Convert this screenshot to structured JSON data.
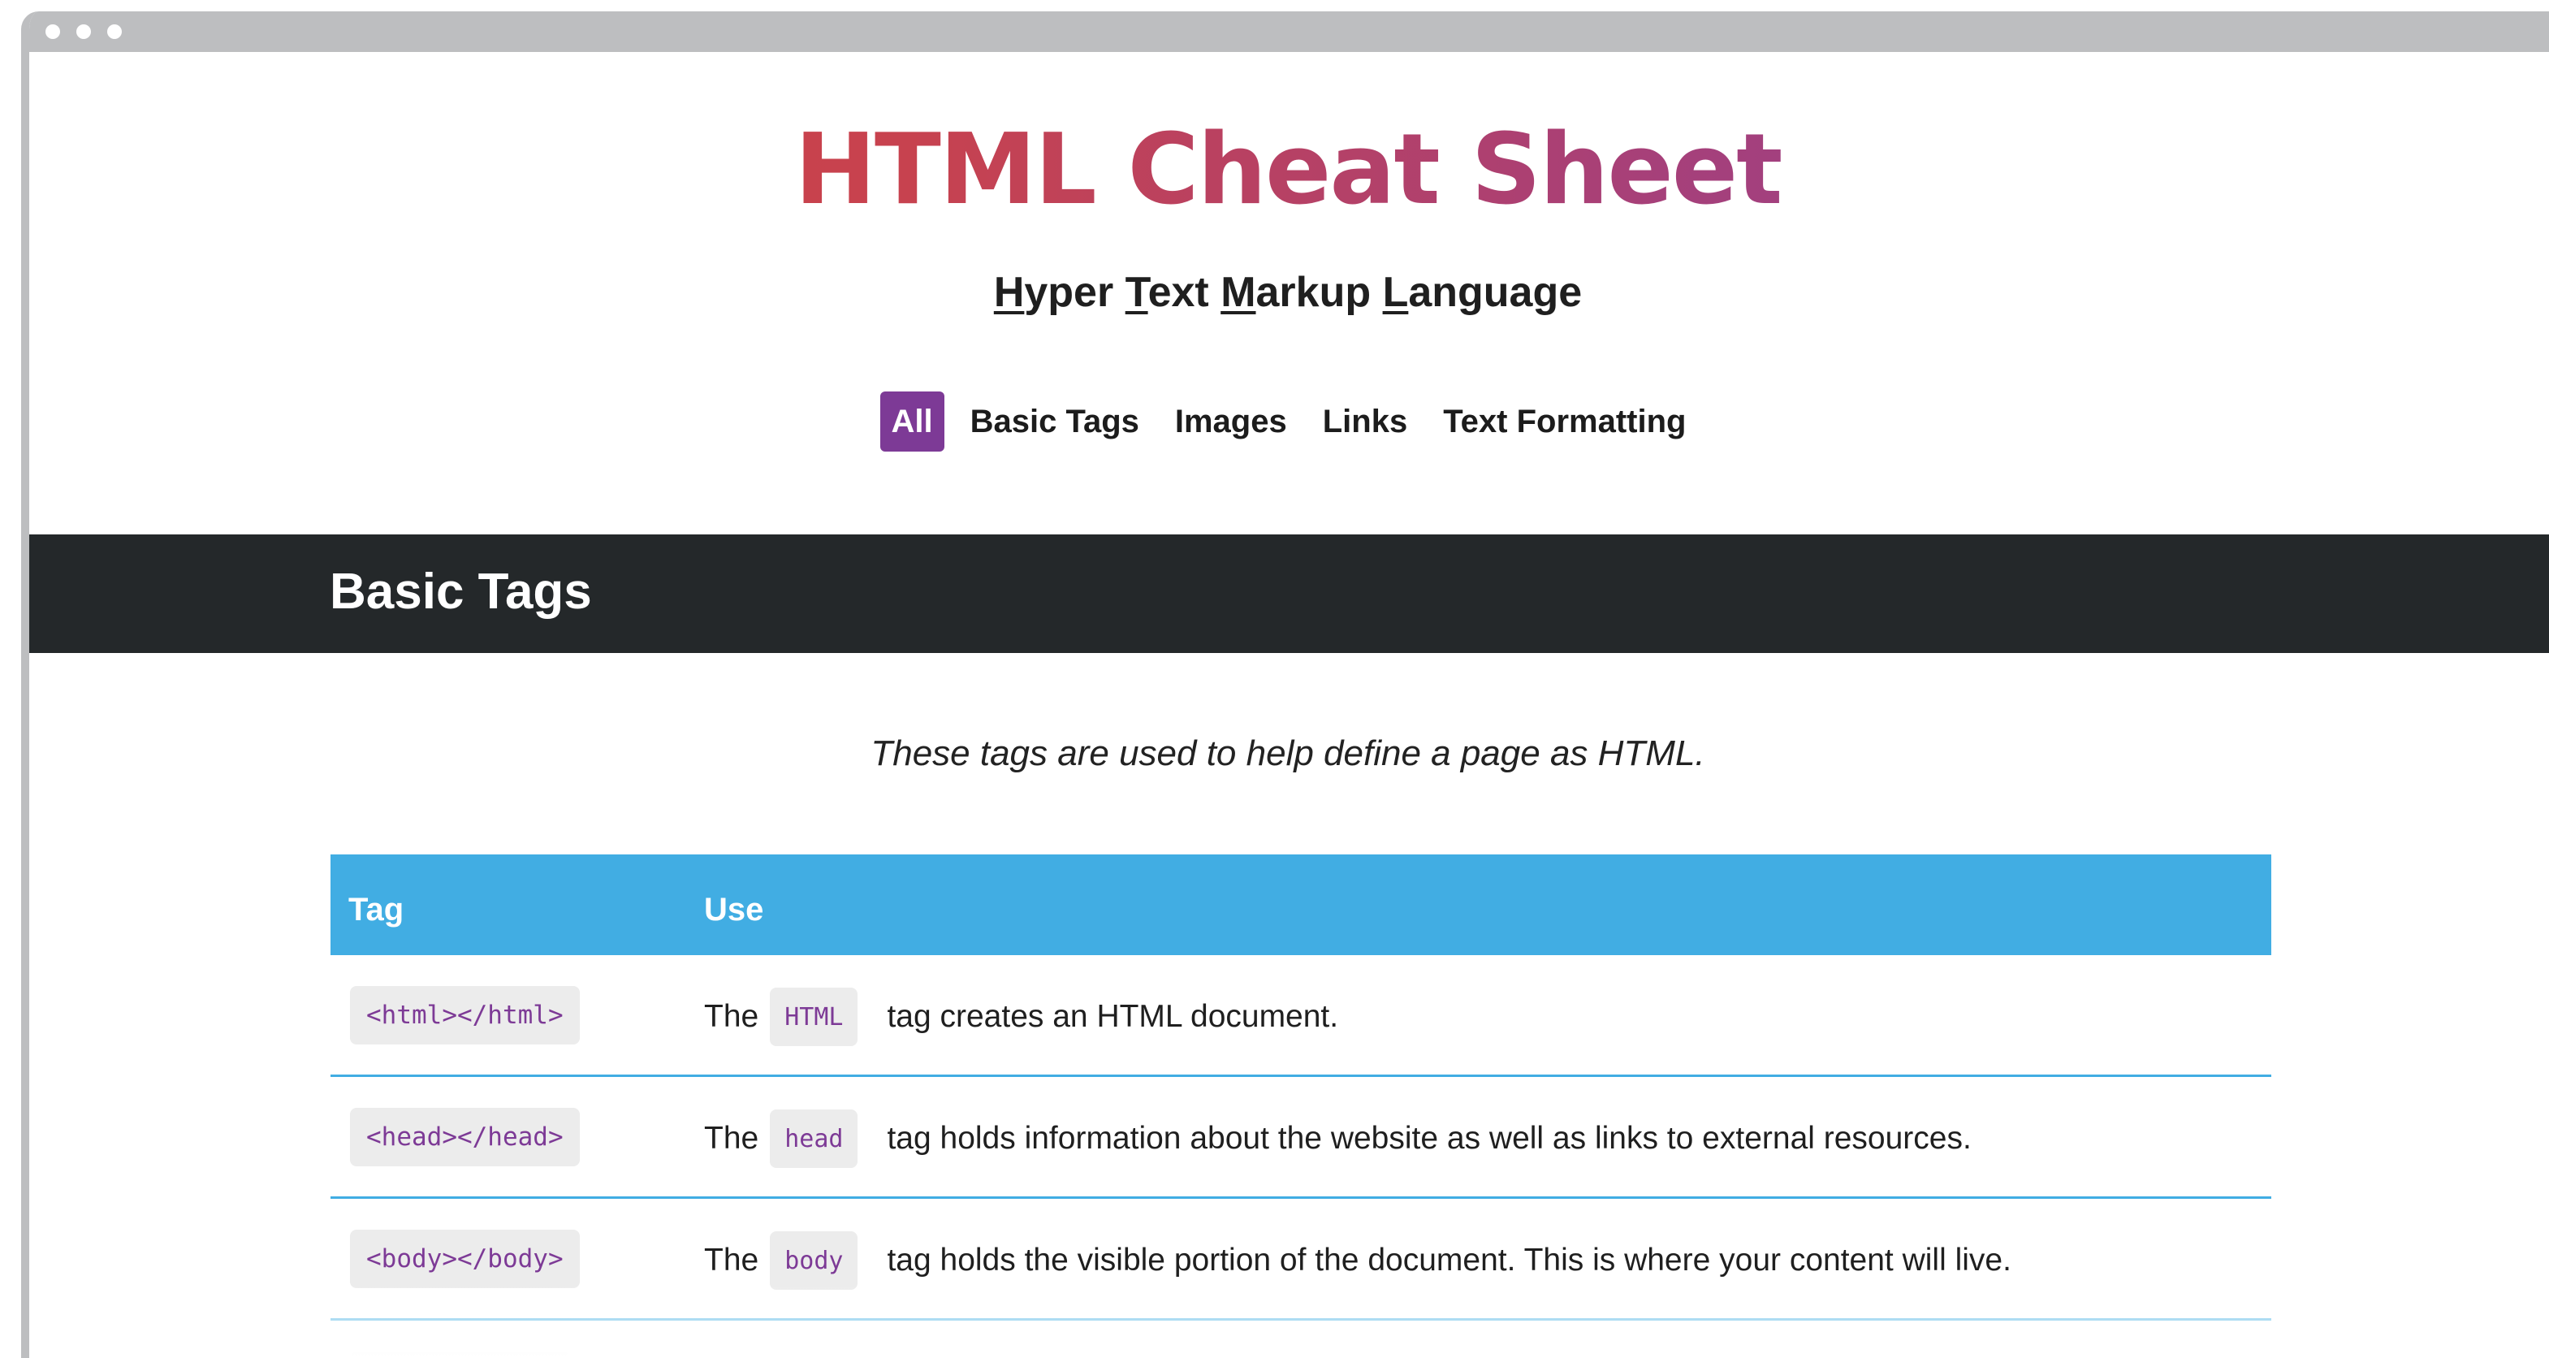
{
  "header": {
    "title": "HTML Cheat Sheet",
    "subtitle": {
      "parts": [
        {
          "u": "H",
          "rest": "yper "
        },
        {
          "u": "T",
          "rest": "ext "
        },
        {
          "u": "M",
          "rest": "arkup "
        },
        {
          "u": "L",
          "rest": "anguage"
        }
      ]
    }
  },
  "nav": {
    "items": [
      {
        "label": "All",
        "active": true
      },
      {
        "label": "Basic Tags",
        "active": false
      },
      {
        "label": "Images",
        "active": false
      },
      {
        "label": "Links",
        "active": false
      },
      {
        "label": "Text Formatting",
        "active": false
      }
    ]
  },
  "section": {
    "title": "Basic Tags",
    "description": "These tags are used to help define a page as HTML."
  },
  "table": {
    "headers": {
      "tag": "Tag",
      "use": "Use"
    },
    "rows": [
      {
        "tag": "<html></html>",
        "pre": "The",
        "chip": "HTML",
        "post": "tag creates an HTML document."
      },
      {
        "tag": "<head></head>",
        "pre": "The",
        "chip": "head",
        "post": "tag holds information about the website as well as links to external resources."
      },
      {
        "tag": "<body></body>",
        "pre": "The",
        "chip": "body",
        "post": "tag holds the visible portion of the document. This is where your content will live."
      }
    ]
  },
  "colors": {
    "accent_purple": "#7d3a96",
    "table_header_blue": "#41ade3",
    "section_bar_dark": "#24282a",
    "title_gradient_start": "#d2463f",
    "title_gradient_end": "#8d3d97"
  }
}
